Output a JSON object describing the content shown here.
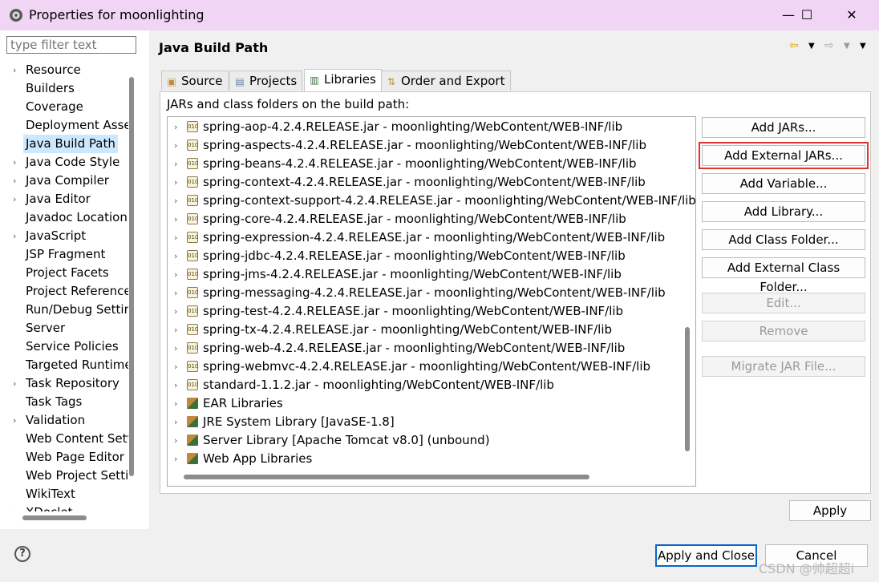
{
  "window": {
    "title": "Properties for moonlighting",
    "minimize": "—",
    "maximize": "☐",
    "close": "✕"
  },
  "filter": {
    "placeholder": "type filter text"
  },
  "tree": [
    {
      "label": "Resource",
      "expandable": true
    },
    {
      "label": "Builders",
      "expandable": false
    },
    {
      "label": "Coverage",
      "expandable": false
    },
    {
      "label": "Deployment Assembly",
      "expandable": false
    },
    {
      "label": "Java Build Path",
      "expandable": false,
      "selected": true
    },
    {
      "label": "Java Code Style",
      "expandable": true
    },
    {
      "label": "Java Compiler",
      "expandable": true
    },
    {
      "label": "Java Editor",
      "expandable": true
    },
    {
      "label": "Javadoc Location",
      "expandable": false
    },
    {
      "label": "JavaScript",
      "expandable": true
    },
    {
      "label": "JSP Fragment",
      "expandable": false
    },
    {
      "label": "Project Facets",
      "expandable": false
    },
    {
      "label": "Project References",
      "expandable": false
    },
    {
      "label": "Run/Debug Settings",
      "expandable": false
    },
    {
      "label": "Server",
      "expandable": false
    },
    {
      "label": "Service Policies",
      "expandable": false
    },
    {
      "label": "Targeted Runtimes",
      "expandable": false
    },
    {
      "label": "Task Repository",
      "expandable": true
    },
    {
      "label": "Task Tags",
      "expandable": false
    },
    {
      "label": "Validation",
      "expandable": true
    },
    {
      "label": "Web Content Settings",
      "expandable": false
    },
    {
      "label": "Web Page Editor",
      "expandable": false
    },
    {
      "label": "Web Project Settings",
      "expandable": false
    },
    {
      "label": "WikiText",
      "expandable": false
    },
    {
      "label": "XDoclet",
      "expandable": true
    }
  ],
  "heading": "Java Build Path",
  "tabs": [
    {
      "label": "Source",
      "icon": "source-folder-icon",
      "active": false
    },
    {
      "label": "Projects",
      "icon": "projects-icon",
      "active": false
    },
    {
      "label": "Libraries",
      "icon": "libraries-icon",
      "active": true
    },
    {
      "label": "Order and Export",
      "icon": "order-export-icon",
      "active": false
    }
  ],
  "description": "JARs and class folders on the build path:",
  "entries": [
    {
      "label": "spring-aop-4.2.4.RELEASE.jar - moonlighting/WebContent/WEB-INF/lib",
      "kind": "jar"
    },
    {
      "label": "spring-aspects-4.2.4.RELEASE.jar - moonlighting/WebContent/WEB-INF/lib",
      "kind": "jar"
    },
    {
      "label": "spring-beans-4.2.4.RELEASE.jar - moonlighting/WebContent/WEB-INF/lib",
      "kind": "jar"
    },
    {
      "label": "spring-context-4.2.4.RELEASE.jar - moonlighting/WebContent/WEB-INF/lib",
      "kind": "jar"
    },
    {
      "label": "spring-context-support-4.2.4.RELEASE.jar - moonlighting/WebContent/WEB-INF/lib",
      "kind": "jar"
    },
    {
      "label": "spring-core-4.2.4.RELEASE.jar - moonlighting/WebContent/WEB-INF/lib",
      "kind": "jar"
    },
    {
      "label": "spring-expression-4.2.4.RELEASE.jar - moonlighting/WebContent/WEB-INF/lib",
      "kind": "jar"
    },
    {
      "label": "spring-jdbc-4.2.4.RELEASE.jar - moonlighting/WebContent/WEB-INF/lib",
      "kind": "jar"
    },
    {
      "label": "spring-jms-4.2.4.RELEASE.jar - moonlighting/WebContent/WEB-INF/lib",
      "kind": "jar"
    },
    {
      "label": "spring-messaging-4.2.4.RELEASE.jar - moonlighting/WebContent/WEB-INF/lib",
      "kind": "jar"
    },
    {
      "label": "spring-test-4.2.4.RELEASE.jar - moonlighting/WebContent/WEB-INF/lib",
      "kind": "jar"
    },
    {
      "label": "spring-tx-4.2.4.RELEASE.jar - moonlighting/WebContent/WEB-INF/lib",
      "kind": "jar"
    },
    {
      "label": "spring-web-4.2.4.RELEASE.jar - moonlighting/WebContent/WEB-INF/lib",
      "kind": "jar"
    },
    {
      "label": "spring-webmvc-4.2.4.RELEASE.jar - moonlighting/WebContent/WEB-INF/lib",
      "kind": "jar"
    },
    {
      "label": "standard-1.1.2.jar - moonlighting/WebContent/WEB-INF/lib",
      "kind": "jar"
    },
    {
      "label": "EAR Libraries",
      "kind": "library"
    },
    {
      "label": "JRE System Library [JavaSE-1.8]",
      "kind": "library"
    },
    {
      "label": "Server Library [Apache Tomcat v8.0] (unbound)",
      "kind": "library"
    },
    {
      "label": "Web App Libraries",
      "kind": "library"
    }
  ],
  "jar_icon_text": "010",
  "buttons": [
    {
      "label": "Add JARs...",
      "name": "add-jars-button",
      "enabled": true
    },
    {
      "label": "Add External JARs...",
      "name": "add-external-jars-button",
      "enabled": true,
      "highlighted": true
    },
    {
      "label": "Add Variable...",
      "name": "add-variable-button",
      "enabled": true
    },
    {
      "label": "Add Library...",
      "name": "add-library-button",
      "enabled": true
    },
    {
      "label": "Add Class Folder...",
      "name": "add-class-folder-button",
      "enabled": true
    },
    {
      "label": "Add External Class Folder...",
      "name": "add-external-class-folder-button",
      "enabled": true
    },
    {
      "label": "Edit...",
      "name": "edit-button",
      "enabled": false
    },
    {
      "label": "Remove",
      "name": "remove-button",
      "enabled": false
    },
    {
      "label": "Migrate JAR File...",
      "name": "migrate-jar-button",
      "enabled": false
    }
  ],
  "apply": "Apply",
  "footer": {
    "apply_close": "Apply and Close",
    "cancel": "Cancel",
    "help": "?"
  },
  "watermark": "CSDN @帅超超i",
  "colors": {
    "title_bar": "#f1d5f5",
    "selection": "#cce8ff",
    "highlight_border": "#e03030",
    "default_button_border": "#0a64c8"
  }
}
